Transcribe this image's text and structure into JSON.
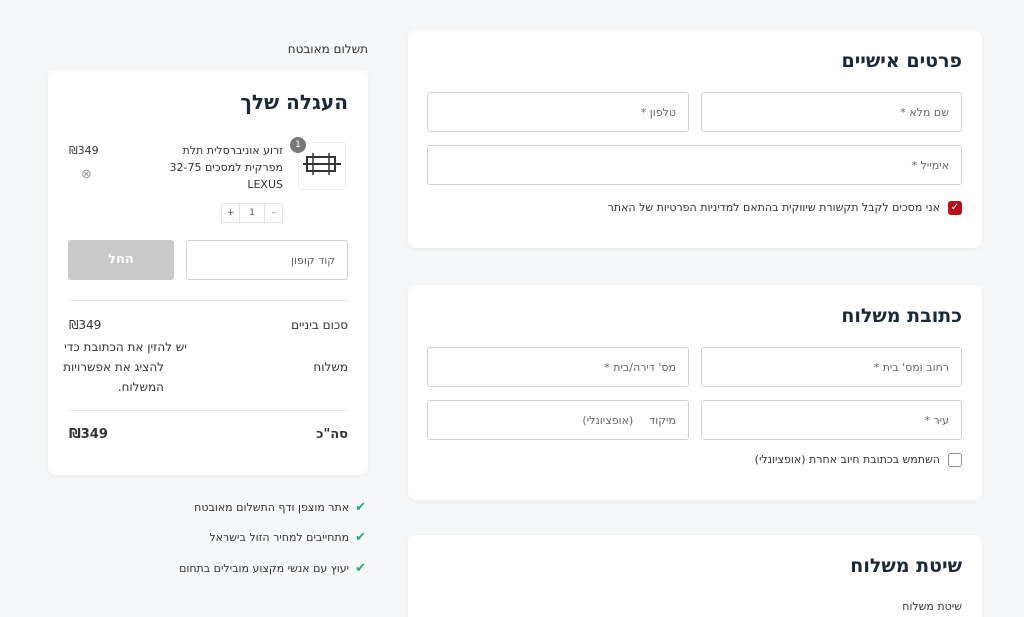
{
  "secure_payment_label": "תשלום מאובטח",
  "personal": {
    "title": "פרטים אישיים",
    "full_name_placeholder": "שם מלא *",
    "phone_placeholder": "טלפון *",
    "email_placeholder": "אימייל *",
    "marketing_consent": "אני מסכים לקבל תקשורת שיווקית בהתאם למדיניות הפרטיות של האתר"
  },
  "shipping_address": {
    "title": "כתובת משלוח",
    "street_placeholder": "רחוב ומס' בית *",
    "apt_placeholder": "מס' דירה/בית *",
    "city_placeholder": "עיר *",
    "zip_label": "מיקוד",
    "zip_optional": "(אופציונלי)",
    "billing_option": "השתמש בכתובת חיוב אחרת (אופציונלי)"
  },
  "shipping_method": {
    "title": "שיטת משלוח",
    "label": "שיטת משלוח"
  },
  "cart": {
    "title": "העגלה שלך",
    "item": {
      "badge": "1",
      "name_line1": "זרוע אוניברסלית תלת",
      "name_line2": "מפרקית למסכים 32-75",
      "name_line3": "LEXUS",
      "price": "₪349",
      "qty": "1",
      "plus": "+",
      "minus": "-",
      "remove": "⊗"
    },
    "coupon_placeholder": "קוד קופון",
    "apply_label": "החל",
    "subtotal_label": "סכום ביניים",
    "subtotal_value": "₪349",
    "shipping_label": "משלוח",
    "shipping_note_1": "יש להזין את הכתובת כדי",
    "shipping_note_2": "להציג את אפשרויות",
    "shipping_note_3": "המשלוח.",
    "total_label": "סה\"כ",
    "total_value": "₪349"
  },
  "trust": [
    "אתר מוצפן ודף התשלום מאובטח",
    "מתחייבים למחיר הזול בישראל",
    "יעוץ עם אנשי מקצוע מובילים בתחום"
  ],
  "colors": {
    "accent_red": "#b3121d",
    "title_navy": "#1b2a3a",
    "check_green": "#2aa876",
    "apply_gray": "#c9c9c9"
  }
}
